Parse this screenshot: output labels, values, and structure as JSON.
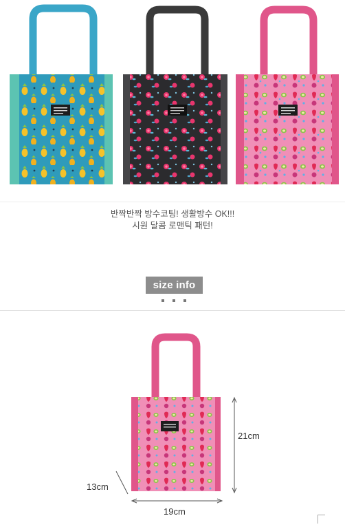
{
  "products": {
    "bags": [
      {
        "name": "pineapple",
        "handle_color": "#3aa6c8",
        "body_color": "#2f9bbb",
        "side_color": "#5cc3b2"
      },
      {
        "name": "black-rose",
        "handle_color": "#3a3a3a",
        "body_color": "#2b2b2e",
        "side_color": "#454548"
      },
      {
        "name": "strawberry-kiwi",
        "handle_color": "#e0568a",
        "body_color": "#f08fb7",
        "side_color": "#e0568a"
      }
    ],
    "caption_line1": "반짝반짝 방수코팅! 생활방수 OK!!!",
    "caption_line2": "시원 달콤 로맨틱 패턴!"
  },
  "size_info": {
    "badge_label": "size info",
    "height_label": "21cm",
    "width_label": "19cm",
    "depth_label": "13cm"
  },
  "colors": {
    "text": "#555555",
    "badge_bg": "#8d8d8d"
  }
}
